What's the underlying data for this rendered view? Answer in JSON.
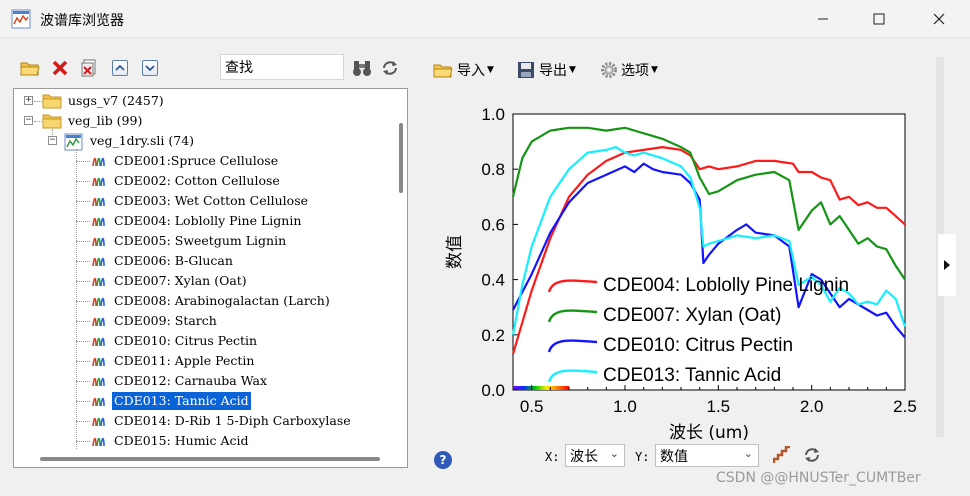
{
  "window": {
    "title": "波谱库浏览器",
    "accent": "#0a64d8"
  },
  "left_toolbar": {
    "icons": [
      "open-folder-icon",
      "delete-icon",
      "remove-file-icon",
      "move-up-icon",
      "move-down-icon"
    ],
    "search_value": "查找",
    "find_icon": "binoculars-icon",
    "refresh_icon": "refresh-icon"
  },
  "tree": {
    "roots": [
      {
        "label": "usgs_v7  (2457)",
        "expanded": false
      },
      {
        "label": "veg_lib  (99)",
        "expanded": true
      }
    ],
    "library": {
      "label": "veg_1dry.sli  (74)",
      "expanded": true
    },
    "spectra": [
      {
        "label": "CDE001:Spruce Cellulose"
      },
      {
        "label": "CDE002: Cotton Cellulose"
      },
      {
        "label": "CDE003: Wet Cotton Cellulose"
      },
      {
        "label": "CDE004: Loblolly Pine Lignin"
      },
      {
        "label": "CDE005: Sweetgum Lignin"
      },
      {
        "label": "CDE006: B-Glucan"
      },
      {
        "label": "CDE007: Xylan (Oat)"
      },
      {
        "label": "CDE008: Arabinogalactan (Larch)"
      },
      {
        "label": "CDE009: Starch"
      },
      {
        "label": "CDE010: Citrus Pectin"
      },
      {
        "label": "CDE011: Apple Pectin"
      },
      {
        "label": "CDE012: Carnauba Wax"
      },
      {
        "label": "CDE013: Tannic Acid",
        "selected": true
      },
      {
        "label": "CDE014: D-Rib 1 5-Diph Carboxylase"
      },
      {
        "label": "CDE015: Humic Acid"
      }
    ]
  },
  "right_toolbar": {
    "import_label": "导入",
    "export_label": "导出",
    "options_label": "选项"
  },
  "axis_select": {
    "x_label": "X:",
    "x_value": "波长",
    "y_label": "Y:",
    "y_value": "数值"
  },
  "help_glyph": "?",
  "watermark": "CSDN @@HNUSTer_CUMTBer",
  "chart_data": {
    "type": "line",
    "xlabel": "波长 (um)",
    "ylabel": "数值",
    "xlim": [
      0.4,
      2.5
    ],
    "ylim": [
      0.0,
      1.0
    ],
    "xticks": [
      "0.5",
      "1.0",
      "1.5",
      "2.0",
      "2.5"
    ],
    "yticks": [
      "0.0",
      "0.2",
      "0.4",
      "0.6",
      "0.8",
      "1.0"
    ],
    "legend_position": "bottom-left inside plot",
    "series": [
      {
        "name": "CDE004: Loblolly Pine Lignin",
        "color": "#ff1a1a",
        "x": [
          0.4,
          0.5,
          0.6,
          0.7,
          0.8,
          0.9,
          1.0,
          1.1,
          1.2,
          1.3,
          1.35,
          1.4,
          1.45,
          1.5,
          1.6,
          1.7,
          1.8,
          1.9,
          1.93,
          2.0,
          2.05,
          2.1,
          2.15,
          2.2,
          2.25,
          2.3,
          2.35,
          2.4,
          2.45,
          2.5
        ],
        "y": [
          0.13,
          0.36,
          0.55,
          0.7,
          0.78,
          0.83,
          0.86,
          0.87,
          0.88,
          0.87,
          0.85,
          0.8,
          0.81,
          0.8,
          0.81,
          0.83,
          0.83,
          0.82,
          0.79,
          0.79,
          0.77,
          0.76,
          0.69,
          0.7,
          0.67,
          0.68,
          0.66,
          0.66,
          0.63,
          0.6
        ]
      },
      {
        "name": "CDE007: Xylan (Oat)",
        "color": "#149614",
        "x": [
          0.4,
          0.45,
          0.5,
          0.6,
          0.7,
          0.8,
          0.9,
          1.0,
          1.1,
          1.2,
          1.3,
          1.35,
          1.4,
          1.45,
          1.5,
          1.6,
          1.7,
          1.8,
          1.88,
          1.93,
          2.0,
          2.05,
          2.1,
          2.15,
          2.2,
          2.25,
          2.3,
          2.35,
          2.4,
          2.45,
          2.5
        ],
        "y": [
          0.7,
          0.84,
          0.9,
          0.94,
          0.95,
          0.95,
          0.94,
          0.95,
          0.93,
          0.91,
          0.88,
          0.86,
          0.77,
          0.71,
          0.72,
          0.76,
          0.78,
          0.79,
          0.76,
          0.58,
          0.65,
          0.68,
          0.6,
          0.63,
          0.58,
          0.53,
          0.55,
          0.52,
          0.51,
          0.45,
          0.4
        ]
      },
      {
        "name": "CDE010: Citrus Pectin",
        "color": "#1414ff",
        "x": [
          0.4,
          0.5,
          0.6,
          0.7,
          0.8,
          0.9,
          1.0,
          1.05,
          1.1,
          1.15,
          1.2,
          1.3,
          1.35,
          1.4,
          1.42,
          1.45,
          1.5,
          1.6,
          1.65,
          1.7,
          1.8,
          1.88,
          1.93,
          2.0,
          2.05,
          2.1,
          2.15,
          2.2,
          2.3,
          2.35,
          2.4,
          2.45,
          2.5
        ],
        "y": [
          0.29,
          0.42,
          0.57,
          0.68,
          0.75,
          0.78,
          0.81,
          0.79,
          0.82,
          0.8,
          0.79,
          0.78,
          0.75,
          0.69,
          0.46,
          0.49,
          0.53,
          0.58,
          0.6,
          0.57,
          0.56,
          0.52,
          0.3,
          0.42,
          0.4,
          0.35,
          0.3,
          0.33,
          0.29,
          0.27,
          0.28,
          0.23,
          0.19
        ]
      },
      {
        "name": "CDE013: Tannic Acid",
        "color": "#14f0ff",
        "x": [
          0.4,
          0.45,
          0.5,
          0.6,
          0.7,
          0.8,
          0.9,
          0.95,
          1.0,
          1.05,
          1.1,
          1.2,
          1.3,
          1.35,
          1.4,
          1.42,
          1.45,
          1.5,
          1.6,
          1.7,
          1.8,
          1.88,
          1.93,
          2.0,
          2.05,
          2.1,
          2.15,
          2.2,
          2.25,
          2.3,
          2.35,
          2.4,
          2.45,
          2.5
        ],
        "y": [
          0.2,
          0.38,
          0.52,
          0.7,
          0.8,
          0.86,
          0.87,
          0.88,
          0.86,
          0.85,
          0.86,
          0.84,
          0.81,
          0.77,
          0.66,
          0.52,
          0.53,
          0.54,
          0.56,
          0.55,
          0.56,
          0.54,
          0.38,
          0.41,
          0.38,
          0.32,
          0.37,
          0.35,
          0.31,
          0.32,
          0.31,
          0.36,
          0.33,
          0.23
        ]
      }
    ]
  }
}
